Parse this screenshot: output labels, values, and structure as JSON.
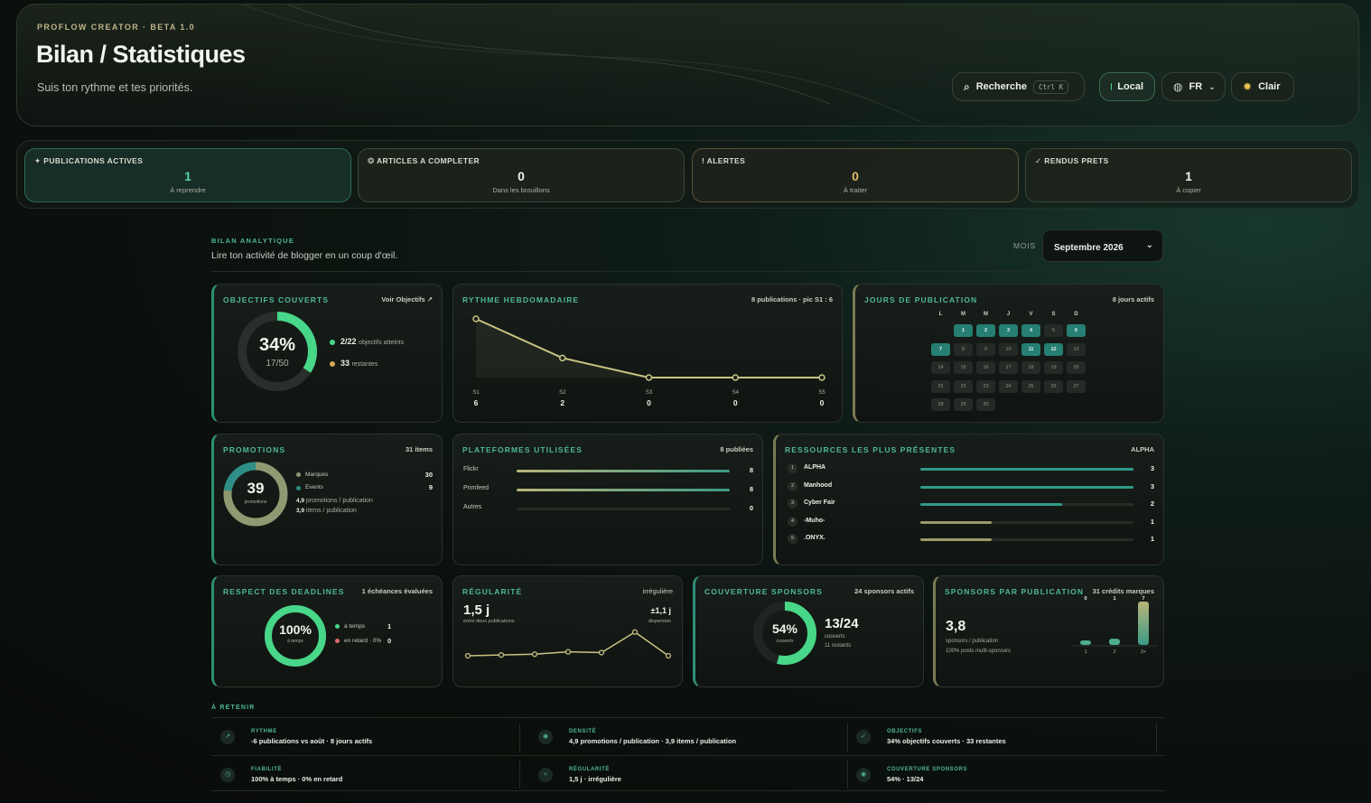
{
  "header": {
    "kicker": "PROFLOW CREATOR · BETA 1.0",
    "title": "Bilan / Statistiques",
    "subtitle": "Suis ton rythme et tes priorités.",
    "search_label": "Recherche",
    "search_shortcut": "Ctrl K",
    "local_label": "Local",
    "lang_label": "FR",
    "theme_label": "Clair"
  },
  "stats": [
    {
      "label": "✦ PUBLICATIONS ACTIVES",
      "value": "1",
      "sub": "À reprendre"
    },
    {
      "label": "❂ ARTICLES A COMPLETER",
      "value": "0",
      "sub": "Dans les brouillons"
    },
    {
      "label": "! ALERTES",
      "value": "0",
      "sub": "À traiter"
    },
    {
      "label": "✓ RENDUS PRETS",
      "value": "1",
      "sub": "À copier"
    }
  ],
  "section": {
    "kicker": "BILAN ANALYTIQUE",
    "desc": "Lire ton activité de blogger en un coup d'œil.",
    "month_label": "MOIS",
    "month_value": "Septembre 2026"
  },
  "objectifs": {
    "title": "OBJECTIFS COUVERTS",
    "link": "Voir Objectifs ↗",
    "percent": "34%",
    "fraction": "17/50",
    "progress": 0.34,
    "l1_val": "2/22",
    "l1_lab": "objectifs atteints",
    "l2_val": "33",
    "l2_lab": "restantes"
  },
  "rythme": {
    "title": "RYTHME HEBDOMADAIRE",
    "meta": "8 publications · pic S1 : 6",
    "chart_data": {
      "type": "line",
      "categories": [
        "S1",
        "S2",
        "S3",
        "S4",
        "S5"
      ],
      "values": [
        6,
        2,
        0,
        0,
        0
      ],
      "ylim": [
        0,
        6
      ]
    }
  },
  "jours": {
    "title": "JOURS DE PUBLICATION",
    "meta": "8 jours actifs",
    "headers": [
      "L",
      "M",
      "M",
      "J",
      "V",
      "S",
      "D"
    ],
    "active_days": [
      1,
      2,
      3,
      4,
      6,
      7,
      11,
      12
    ],
    "start_offset": 1,
    "days_in_month": 30
  },
  "promotions": {
    "title": "PROMOTIONS",
    "meta": "31 items",
    "total": "39",
    "total_lab": "promotions",
    "chart_data": {
      "type": "pie",
      "categories": [
        "Marques",
        "Events"
      ],
      "values": [
        30,
        9
      ]
    },
    "r1_lab": "Marques",
    "r1_val": "30",
    "r2_lab": "Events",
    "r2_val": "9",
    "s1_val": "4,9",
    "s1_lab": "promotions / publication",
    "s2_val": "3,9",
    "s2_lab": "items / publication",
    "colors": {
      "marques": "#8e9a72",
      "events": "#2f8f86"
    }
  },
  "plateformes": {
    "title": "PLATEFORMES UTILISÉES",
    "meta": "8 publiées",
    "chart_data": {
      "type": "bar",
      "categories": [
        "Flickr",
        "Primfeed",
        "Autres"
      ],
      "values": [
        8,
        8,
        0
      ],
      "max": 8
    }
  },
  "ressources": {
    "title": "RESSOURCES LES PLUS PRÉSENTES",
    "meta": "ALPHA",
    "chart_data": {
      "type": "bar",
      "categories": [
        "ALPHA",
        "Manhood",
        "Cyber Fair",
        "-Muho-",
        ".ONYX."
      ],
      "values": [
        3,
        3,
        2,
        1,
        1
      ],
      "max": 3
    }
  },
  "deadlines": {
    "title": "RESPECT DES DEADLINES",
    "meta": "1 échéances évaluées",
    "percent": "100%",
    "pct_lab": "à temps",
    "progress": 1.0,
    "r1_lab": "à temps",
    "r1_val": "1",
    "r2_lab": "en retard · 0%",
    "r2_val": "0"
  },
  "regularite": {
    "title": "RÉGULARITÉ",
    "meta": "irrégulière",
    "big": "1,5 j",
    "big_lab": "entre deux publications",
    "disp": "±1,1 j",
    "disp_lab": "dispersion",
    "chart_data": {
      "type": "line",
      "values": [
        0.0,
        0.1,
        0.2,
        0.5,
        0.4,
        3.0,
        0.0
      ],
      "ylim": [
        0,
        3.2
      ]
    }
  },
  "couverture": {
    "title": "COUVERTURE SPONSORS",
    "meta": "24 sponsors actifs",
    "percent": "54%",
    "pct_lab": "couverts",
    "progress": 0.54,
    "frac": "13/24",
    "l1": "couverts",
    "l2": "11 restants"
  },
  "sponsors_pub": {
    "title": "SPONSORS PAR PUBLICATION",
    "meta": "31 crédits marques",
    "big": "3,8",
    "l1": "sponsors / publication",
    "l2": "100% posts multi-sponsors",
    "chart_data": {
      "type": "bar",
      "categories": [
        "1",
        "2",
        "3+"
      ],
      "values": [
        0,
        1,
        7
      ],
      "ylim": [
        0,
        7
      ]
    }
  },
  "retenir": {
    "kicker": "À RETENIR",
    "items": [
      {
        "icon": "↗",
        "k": "RYTHME",
        "v": "-6 publications vs août · 8 jours actifs"
      },
      {
        "icon": "◉",
        "k": "DENSITÉ",
        "v": "4,9 promotions / publication · 3,9 items / publication"
      },
      {
        "icon": "✓",
        "k": "OBJECTIFS",
        "v": "34% objectifs couverts · 33 restantes"
      },
      {
        "icon": "◷",
        "k": "FIABILITÉ",
        "v": "100% à temps · 0% en retard"
      },
      {
        "icon": "≈",
        "k": "RÉGULARITÉ",
        "v": "1,5 j · irrégulière"
      },
      {
        "icon": "◉",
        "k": "COUVERTURE SPONSORS",
        "v": "54% · 13/24"
      }
    ]
  }
}
